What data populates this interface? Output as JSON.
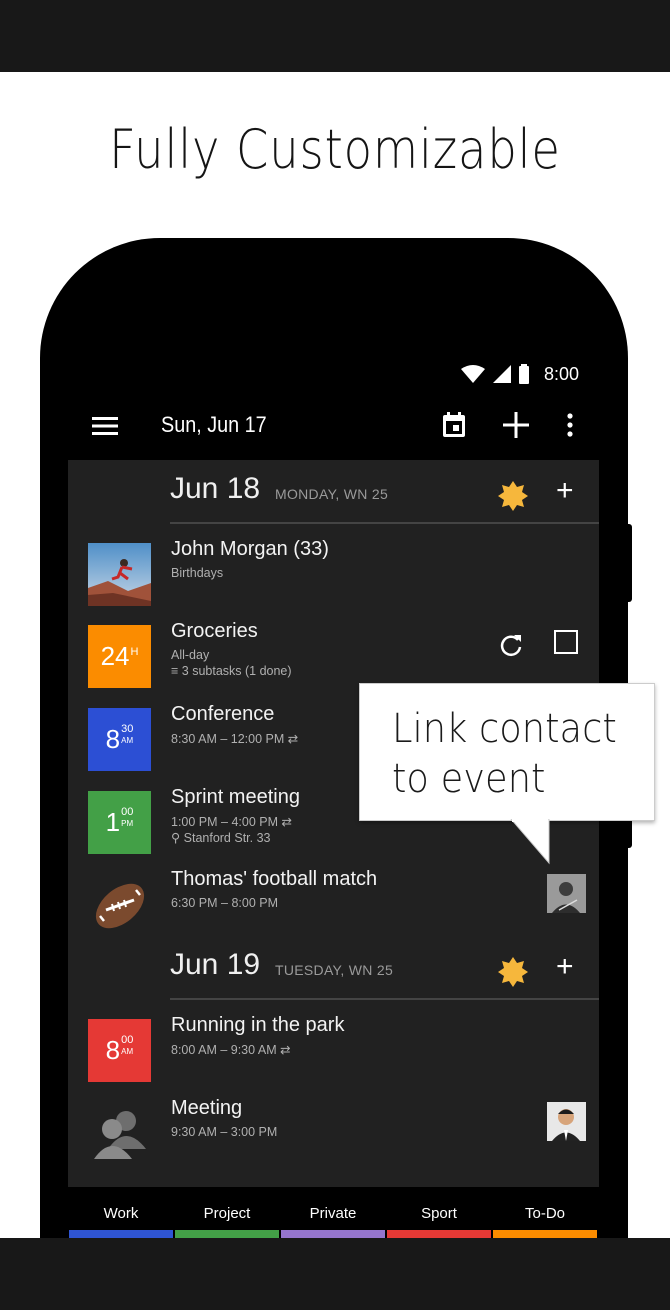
{
  "headline": "Fully Customizable",
  "status_bar": {
    "time": "8:00"
  },
  "app_bar": {
    "title": "Sun, Jun 17"
  },
  "days": [
    {
      "date": "Jun 18",
      "sub": "MONDAY, WN 25"
    },
    {
      "date": "Jun 19",
      "sub": "TUESDAY, WN 25"
    }
  ],
  "events": [
    {
      "name": "John Morgan (33)",
      "meta1": "Birthdays",
      "meta2": ""
    },
    {
      "name": "Groceries",
      "meta1": "All-day",
      "meta2": "≡ 3 subtasks (1 done)",
      "badge_big": "24",
      "badge_sup": "H",
      "badge_color": "#fb8c00"
    },
    {
      "name": "Conference",
      "meta1": "8:30 AM – 12:00 PM ⇄",
      "meta2": "",
      "badge_big": "8",
      "badge_sup": "30",
      "badge_ampm": "AM",
      "badge_color": "#2c4fd4"
    },
    {
      "name": "Sprint meeting",
      "meta1": "1:00 PM – 4:00 PM ⇄",
      "meta2": "⚲ Stanford Str. 33",
      "badge_big": "1",
      "badge_sup": "00",
      "badge_ampm": "PM",
      "badge_color": "#43a047"
    },
    {
      "name": "Thomas' football match",
      "meta1": "6:30 PM – 8:00 PM",
      "meta2": ""
    },
    {
      "name": "Running in the park",
      "meta1": "8:00 AM – 9:30 AM ⇄",
      "meta2": "",
      "badge_big": "8",
      "badge_sup": "00",
      "badge_ampm": "AM",
      "badge_color": "#e53935"
    },
    {
      "name": "Meeting",
      "meta1": "9:30 AM – 3:00 PM",
      "meta2": ""
    }
  ],
  "tooltip": {
    "line1": "Link contact",
    "line2": "to event"
  },
  "tabs": [
    {
      "label": "Work",
      "color": "#2f55d4"
    },
    {
      "label": "Project",
      "color": "#43a047"
    },
    {
      "label": "Private",
      "color": "#9575cd"
    },
    {
      "label": "Sport",
      "color": "#e53935"
    },
    {
      "label": "To-Do",
      "color": "#fb8c00"
    }
  ],
  "colors": {
    "sun": "#f6b73c",
    "screen_bg": "#212121",
    "accent_black": "#000000"
  }
}
